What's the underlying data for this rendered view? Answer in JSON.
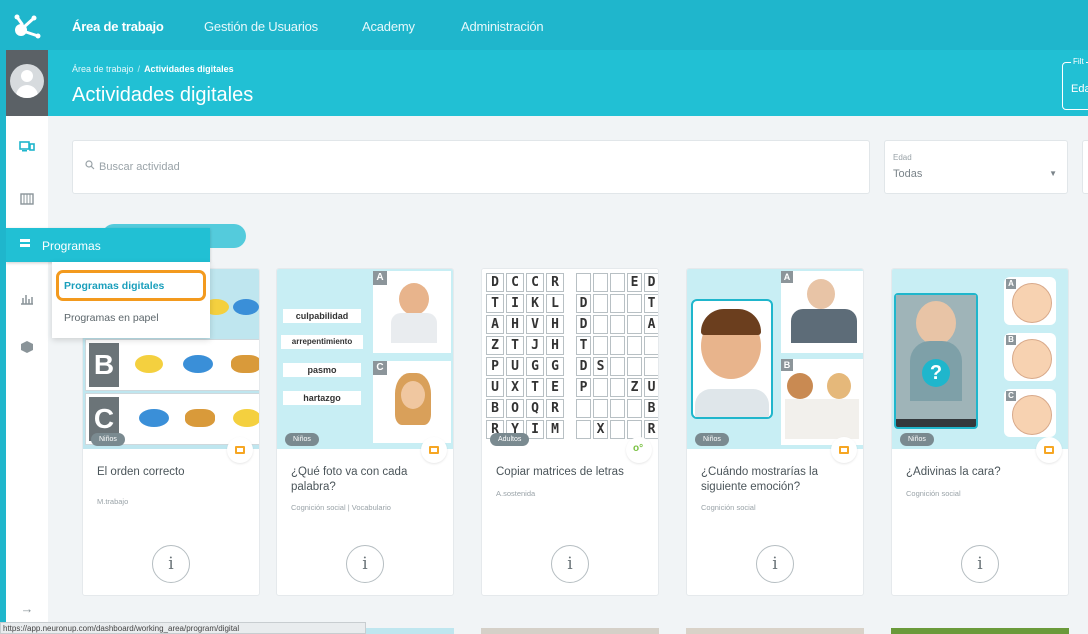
{
  "nav": {
    "items": [
      "Área de trabajo",
      "Gestión de Usuarios",
      "Academy",
      "Administración"
    ],
    "active": 0
  },
  "header": {
    "breadcrumb": [
      "Área de trabajo",
      "Actividades digitales"
    ],
    "title": "Actividades digitales",
    "filter_label": "Filt",
    "filter_value": "Eda"
  },
  "sidebar": {
    "icons": [
      "monitor-icon",
      "table-icon",
      "list-icon",
      "chart-icon",
      "box-icon",
      "arrow-right-icon"
    ],
    "menu_label": "Programas",
    "submenu": [
      "Programas digitales",
      "Programas en papel"
    ],
    "highlighted_submenu": 0
  },
  "search": {
    "placeholder": "Buscar actividad"
  },
  "age_filter": {
    "label": "Edad",
    "value": "Todas"
  },
  "colors": {
    "brand": "#1fb6cc",
    "highlight": "#f39a1e",
    "card_icon": "#f6a623"
  },
  "cards": [
    {
      "title": "El orden correcto",
      "subtitle": "M.trabajo",
      "tag": "Niños",
      "type_icon": "card-icon"
    },
    {
      "title": "¿Qué foto va con cada palabra?",
      "subtitle": "Cognición social | Vocabulario",
      "tag": "Niños",
      "type_icon": "card-icon",
      "words": [
        "culpabilidad",
        "arrepentimiento",
        "pasmo",
        "hartazgo"
      ]
    },
    {
      "title": "Copiar matrices de letras",
      "subtitle": "A.sostenida",
      "tag": "Adultos",
      "type_icon": "game-icon",
      "grid": [
        "DCCR",
        "TIKL",
        "AHVH",
        "ZTJH",
        "PUGG",
        "UXTE",
        "BOQR",
        "RYIM"
      ],
      "grid_right": [
        "   ED",
        "D   T",
        "D   A",
        "T    ",
        "DS   ",
        "P  ZU",
        "    B",
        " X  R"
      ]
    },
    {
      "title": "¿Cuándo mostrarías la siguiente emoción?",
      "subtitle": "Cognición social",
      "tag": "Niños",
      "type_icon": "card-icon"
    },
    {
      "title": "¿Adivinas la cara?",
      "subtitle": "Cognición social",
      "tag": "Niños",
      "type_icon": "card-icon"
    }
  ],
  "statusbar": "https://app.neuronup.com/dashboard/working_area/program/digital"
}
